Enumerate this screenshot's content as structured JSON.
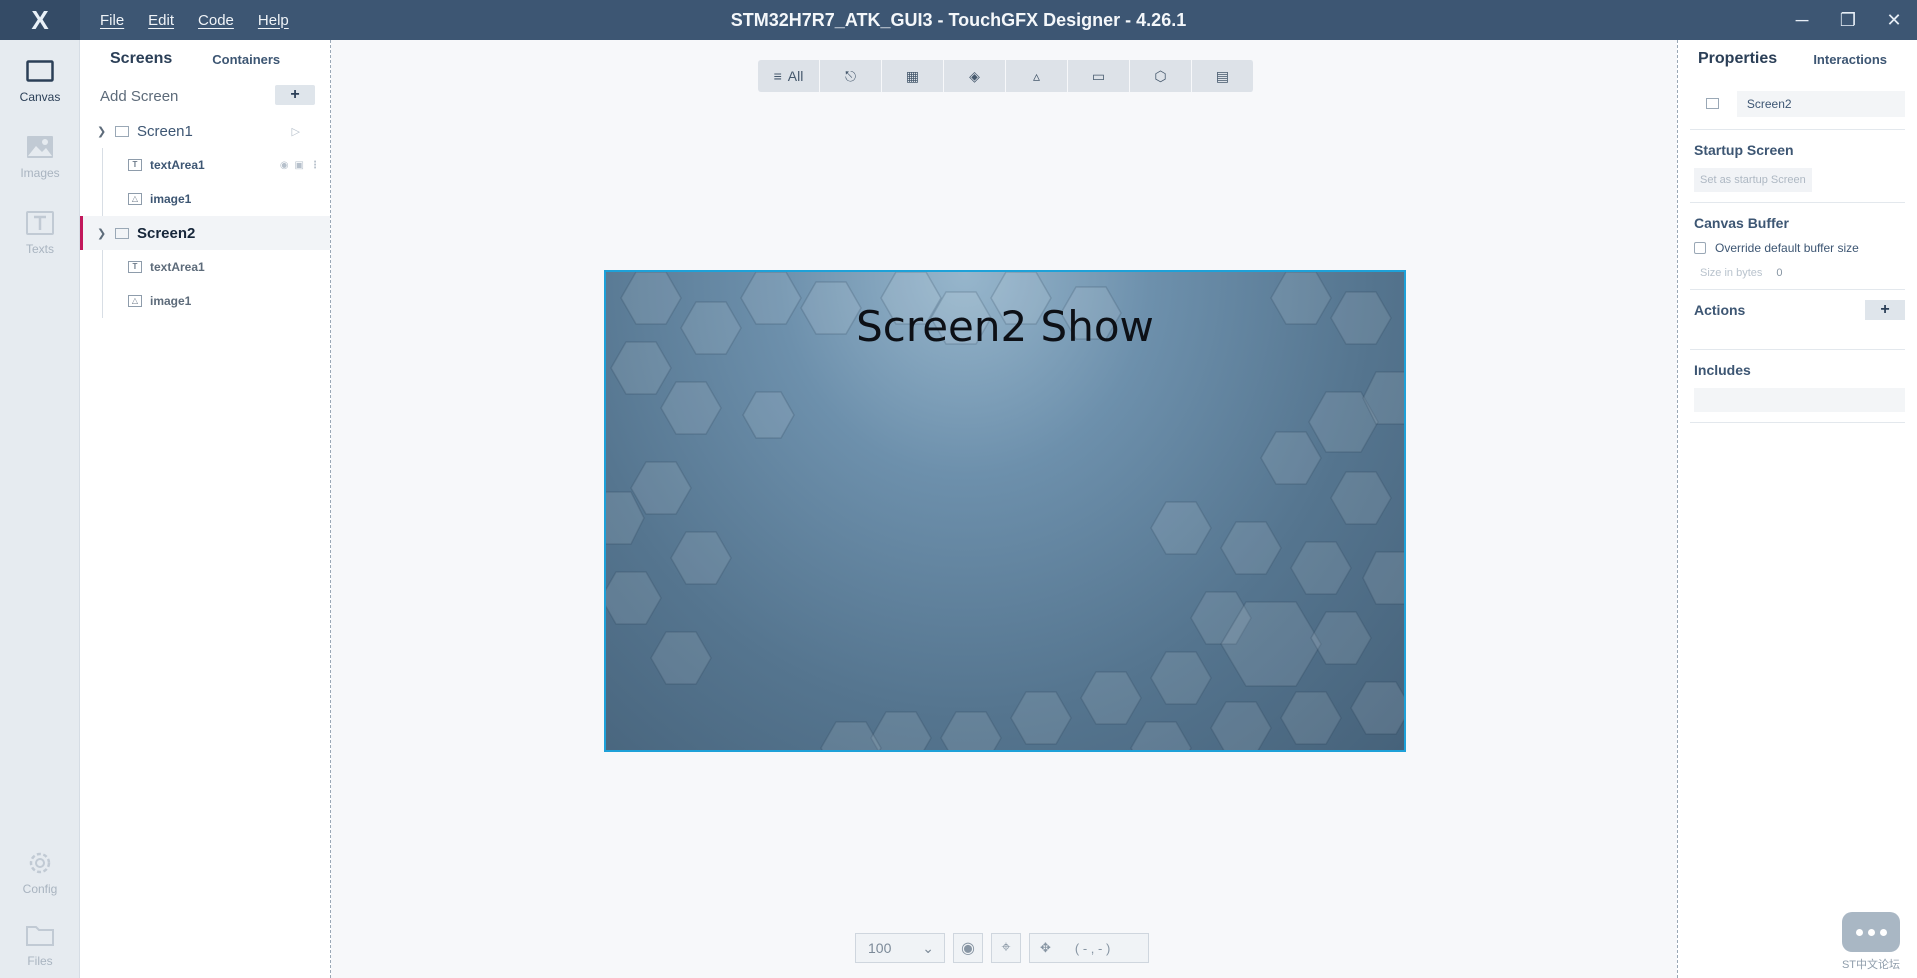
{
  "app": {
    "logo_glyph": "X",
    "window_title": "STM32H7R7_ATK_GUI3 - TouchGFX Designer - 4.26.1",
    "menu": [
      "File",
      "Edit",
      "Code",
      "Help"
    ],
    "window_controls": {
      "minimize": "─",
      "restore": "❐",
      "close": "✕"
    }
  },
  "nav": {
    "items": [
      {
        "label": "Canvas",
        "icon": "canvas-icon",
        "active": true
      },
      {
        "label": "Images",
        "icon": "images-icon",
        "active": false
      },
      {
        "label": "Texts",
        "icon": "texts-icon",
        "active": false
      },
      {
        "label": "Config",
        "icon": "gear-icon",
        "active": false
      },
      {
        "label": "Files",
        "icon": "folder-icon",
        "active": false
      }
    ]
  },
  "screens_panel": {
    "tab_screens": "Screens",
    "tab_containers": "Containers",
    "add_screen_label": "Add Screen",
    "add_button": "+",
    "tree": [
      {
        "name": "Screen1",
        "selected": false,
        "children": [
          {
            "name": "textArea1",
            "type": "text"
          },
          {
            "name": "image1",
            "type": "image"
          }
        ]
      },
      {
        "name": "Screen2",
        "selected": true,
        "children": [
          {
            "name": "textArea1",
            "type": "text"
          },
          {
            "name": "image1",
            "type": "image"
          }
        ]
      }
    ]
  },
  "canvas": {
    "toolbar_all_label": "All",
    "toolbar_icons": [
      "list-icon",
      "interaction-icon",
      "image-icon",
      "layers-icon",
      "shapes-icon",
      "progress-icon",
      "cube-icon",
      "stack-icon"
    ],
    "screen_text": "Screen2 Show",
    "accent_color": "#1ea1d8",
    "zoom_value": "100",
    "coords": "( - , - )"
  },
  "properties": {
    "tab_properties": "Properties",
    "tab_interactions": "Interactions",
    "name_value": "Screen2",
    "startup_title": "Startup Screen",
    "startup_button": "Set as startup Screen",
    "canvas_buffer_title": "Canvas Buffer",
    "override_label": "Override default buffer size",
    "size_label": "Size in bytes",
    "size_value": "0",
    "actions_title": "Actions",
    "actions_add": "+",
    "includes_title": "Includes"
  },
  "forum_badge_label": "ST中文论坛"
}
